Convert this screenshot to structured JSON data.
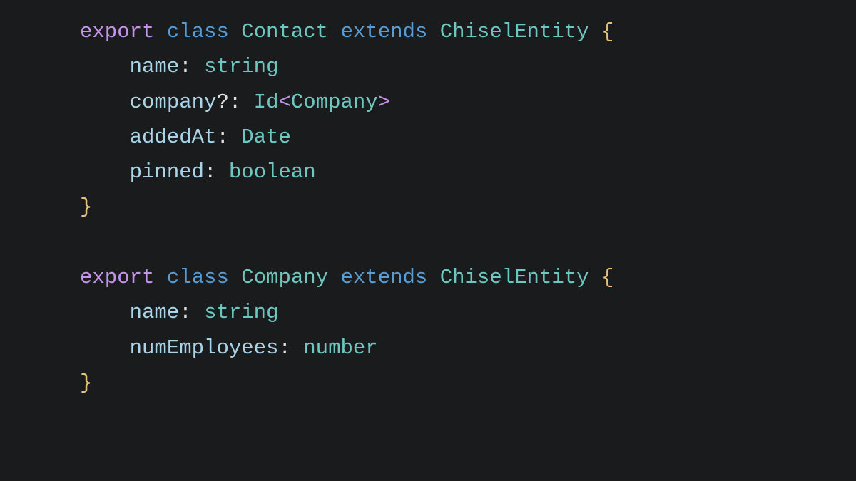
{
  "colors": {
    "background": "#1a1b1d",
    "keyword": "#c792ea",
    "storage": "#569cd6",
    "class": "#6cc7c0",
    "type": "#6cc7c0",
    "ident": "#a9d3e6",
    "punct": "#e0e0e0",
    "brace": "#e5c07b",
    "angle": "#c792ea"
  },
  "lines": {
    "l1_export": "export",
    "l1_class": "class",
    "l1_name": "Contact",
    "l1_extends": "extends",
    "l1_base": "ChiselEntity",
    "l1_open": "{",
    "l2_prop": "name",
    "l2_colon": ":",
    "l2_type": "string",
    "l3_prop": "company",
    "l3_opt": "?",
    "l3_colon": ":",
    "l3_id": "Id",
    "l3_lt": "<",
    "l3_generic": "Company",
    "l3_gt": ">",
    "l4_prop": "addedAt",
    "l4_colon": ":",
    "l4_type": "Date",
    "l5_prop": "pinned",
    "l5_colon": ":",
    "l5_type": "boolean",
    "l6_close": "}",
    "l8_export": "export",
    "l8_class": "class",
    "l8_name": "Company",
    "l8_extends": "extends",
    "l8_base": "ChiselEntity",
    "l8_open": "{",
    "l9_prop": "name",
    "l9_colon": ":",
    "l9_type": "string",
    "l10_prop": "numEmployees",
    "l10_colon": ":",
    "l10_type": "number",
    "l11_close": "}"
  }
}
